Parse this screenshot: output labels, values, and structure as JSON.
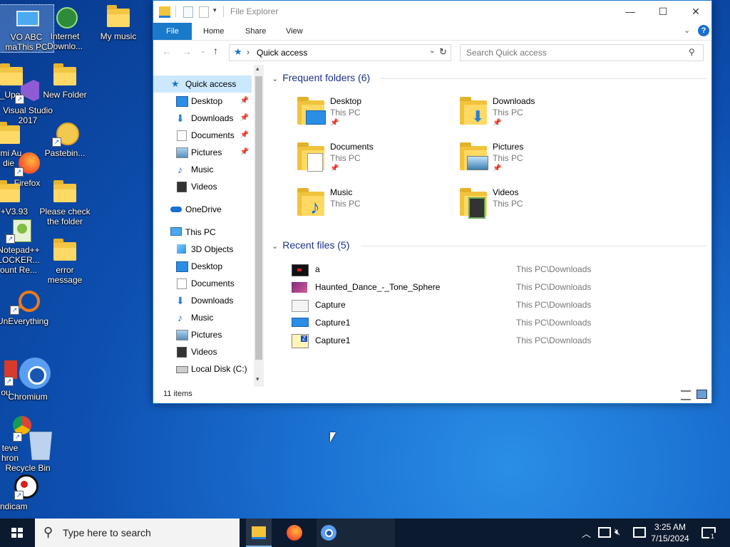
{
  "desktop": {
    "icons": [
      {
        "label": "VO ABC\nmaThis PC"
      },
      {
        "label": "Internet\nDownlo..."
      },
      {
        "label": "My music"
      },
      {
        "label": "O_Upgr..."
      },
      {
        "label": "New Folder"
      },
      {
        "label": "Visual Studio\n2017"
      },
      {
        "label": "omi Au\ndie"
      },
      {
        "label": "Pastebin..."
      },
      {
        "label": "Firefox"
      },
      {
        "label": "RT+V3.93"
      },
      {
        "label": "Please check\nthe folder"
      },
      {
        "label": "Notepad++\nLOCKER...\nount Re..."
      },
      {
        "label": "error\nmessage"
      },
      {
        "label": "UnEverything"
      },
      {
        "label": "ou"
      },
      {
        "label": "Chromium"
      },
      {
        "label": "teve\nhron"
      },
      {
        "label": "Recycle Bin"
      },
      {
        "label": "andicam"
      }
    ]
  },
  "window": {
    "title": "File Explorer",
    "controls": {
      "minimize": "—",
      "maximize": "☐",
      "close": "✕"
    },
    "ribbon": {
      "tabs": [
        "File",
        "Home",
        "Share",
        "View"
      ]
    },
    "address": {
      "path": "Quick access",
      "separator": "›"
    },
    "search": {
      "placeholder": "Search Quick access"
    },
    "nav": {
      "quick_access": "Quick access",
      "pinned": [
        "Desktop",
        "Downloads",
        "Documents",
        "Pictures"
      ],
      "unpinned": [
        "Music",
        "Videos"
      ],
      "onedrive": "OneDrive",
      "this_pc": "This PC",
      "pc_items": [
        "3D Objects",
        "Desktop",
        "Documents",
        "Downloads",
        "Music",
        "Pictures",
        "Videos",
        "Local Disk (C:)"
      ]
    },
    "content": {
      "frequent_header": "Frequent folders (6)",
      "folders": [
        {
          "name": "Desktop",
          "location": "This PC",
          "pinned": true
        },
        {
          "name": "Downloads",
          "location": "This PC",
          "pinned": true
        },
        {
          "name": "Documents",
          "location": "This PC",
          "pinned": true
        },
        {
          "name": "Pictures",
          "location": "This PC",
          "pinned": true
        },
        {
          "name": "Music",
          "location": "This PC",
          "pinned": false
        },
        {
          "name": "Videos",
          "location": "This PC",
          "pinned": false
        }
      ],
      "recent_header": "Recent files (5)",
      "recent": [
        {
          "name": "a",
          "path": "This PC\\Downloads"
        },
        {
          "name": "Haunted_Dance_-_Tone_Sphere",
          "path": "This PC\\Downloads"
        },
        {
          "name": "Capture",
          "path": "This PC\\Downloads"
        },
        {
          "name": "Capture1",
          "path": "This PC\\Downloads"
        },
        {
          "name": "Capture1",
          "path": "This PC\\Downloads"
        }
      ]
    },
    "status": {
      "items": "11 items"
    }
  },
  "taskbar": {
    "search_placeholder": "Type here to search",
    "time": "3:25 AM",
    "date": "7/15/2024",
    "notifications": "1"
  },
  "colors": {
    "accent": "#1979ca",
    "selection": "#cce8ff",
    "taskbar": "#0b1a2e"
  }
}
